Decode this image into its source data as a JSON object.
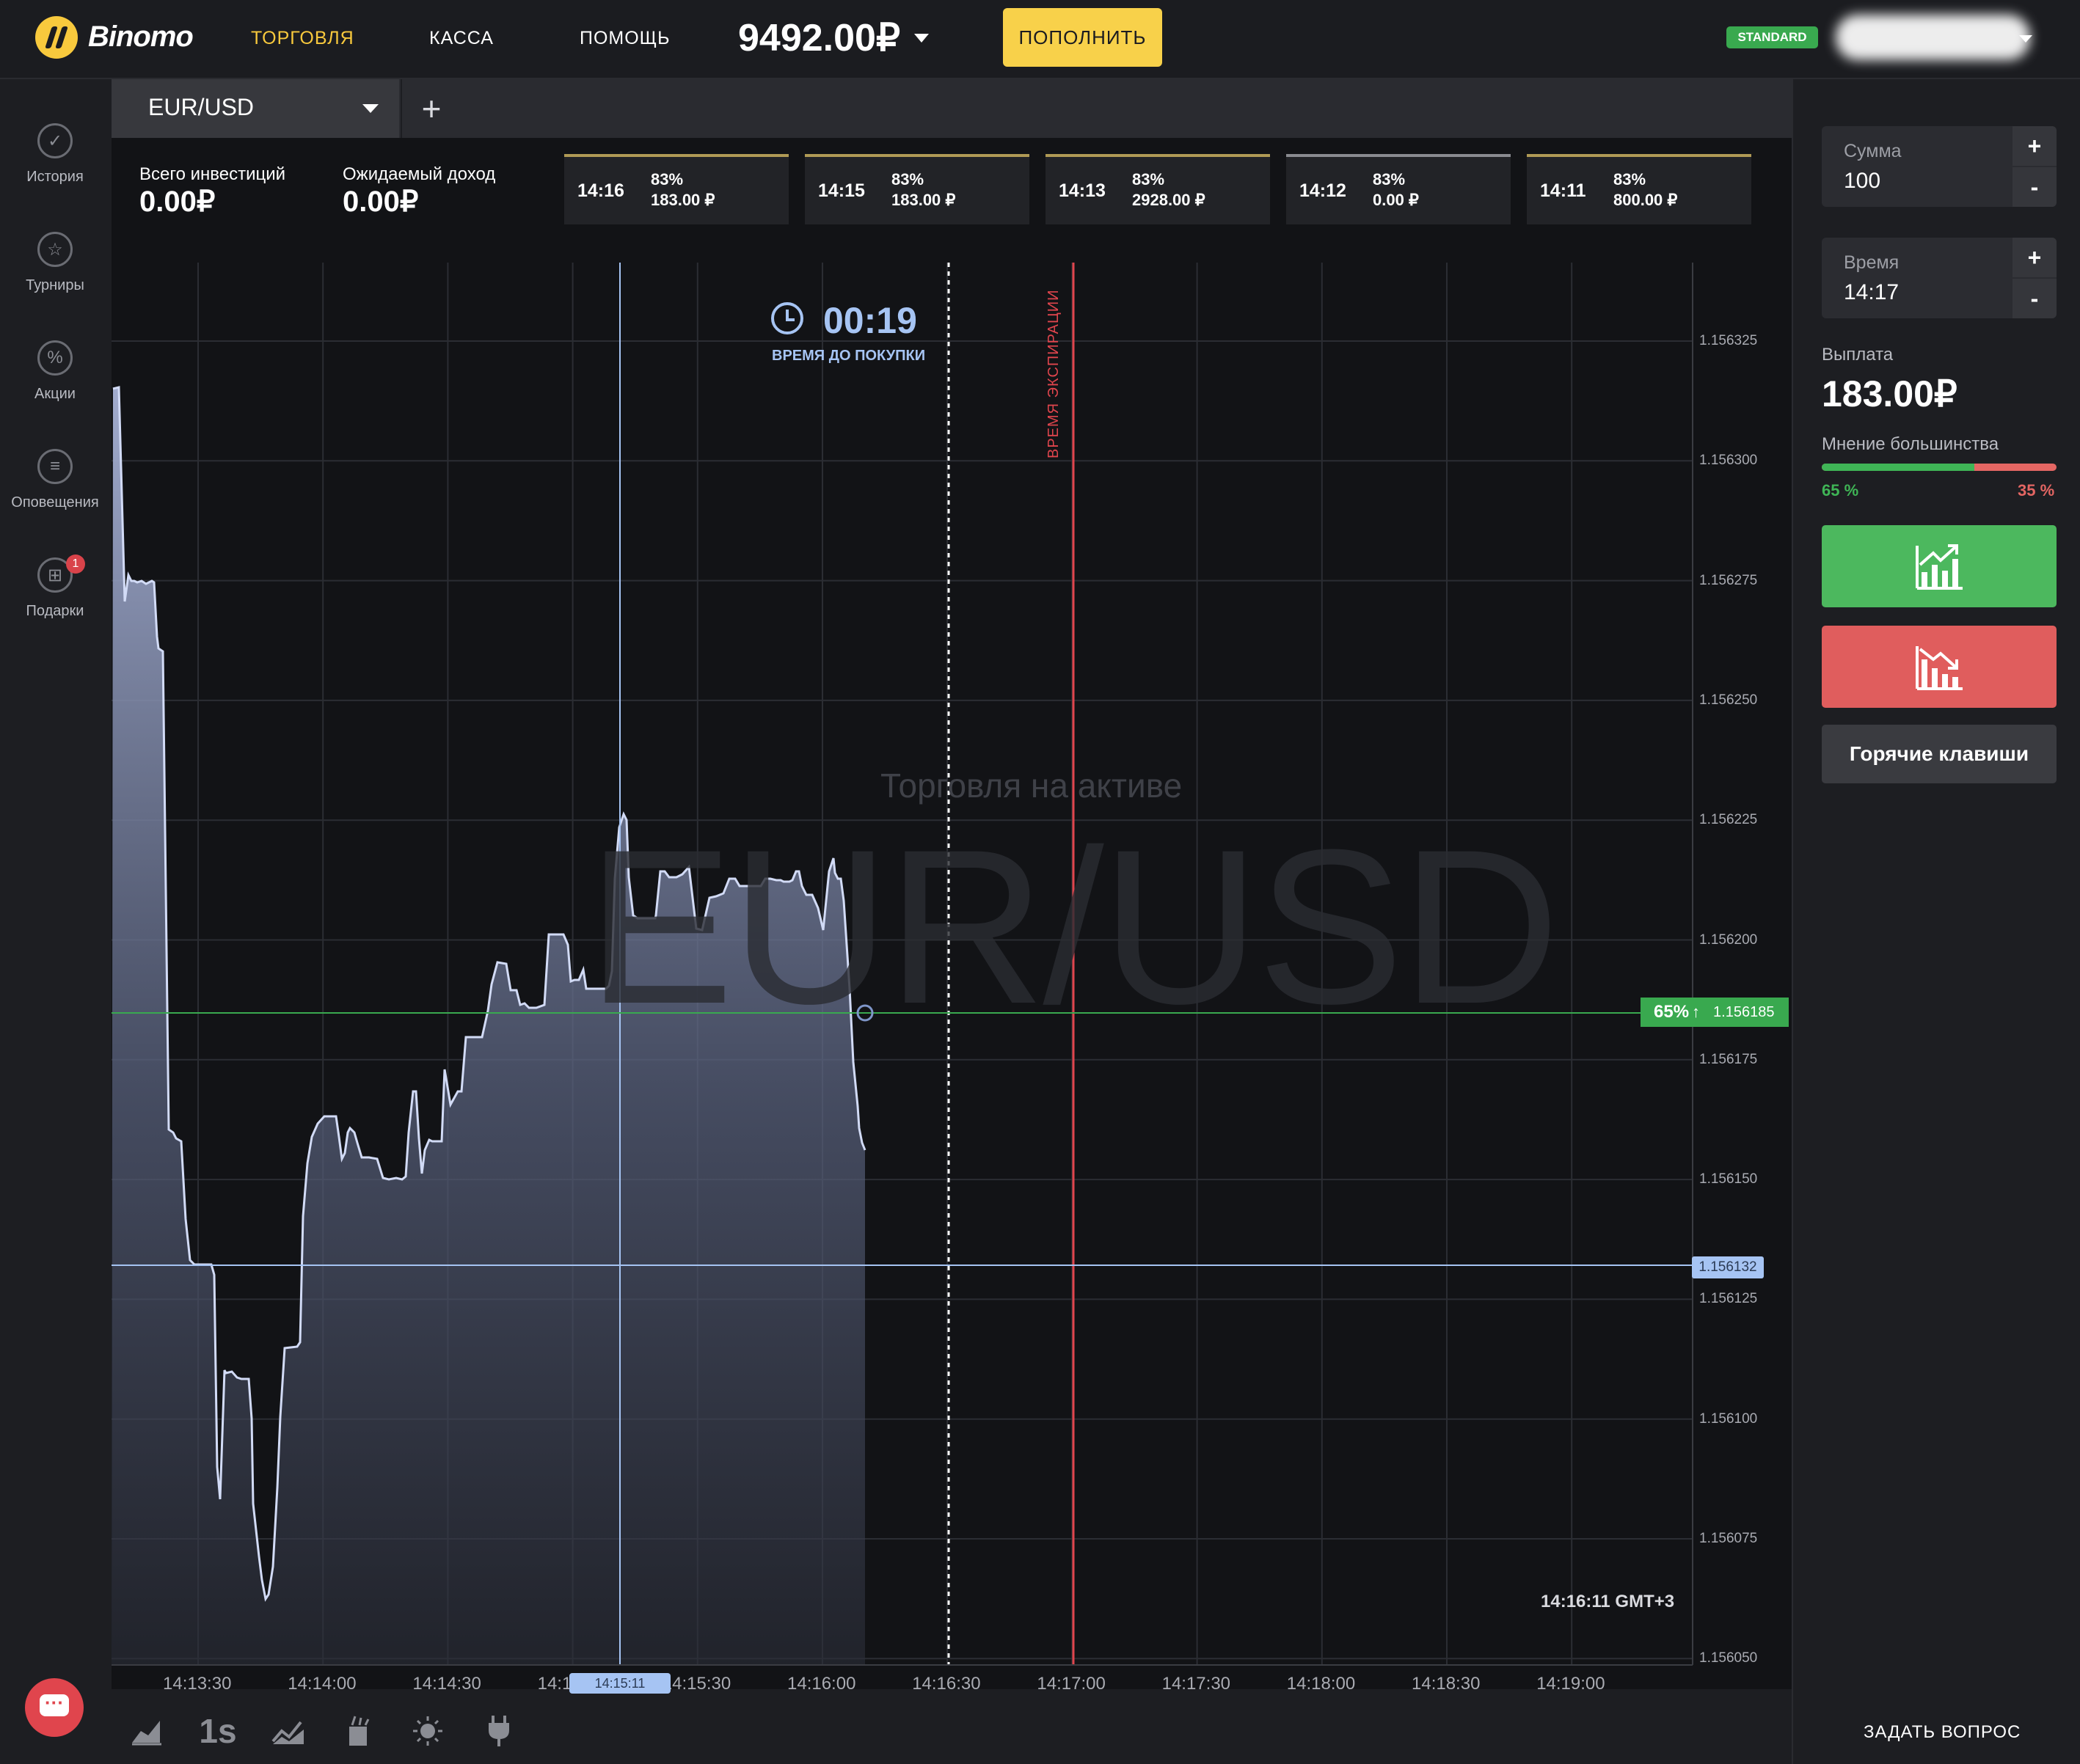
{
  "header": {
    "logo_text": "Binomo",
    "nav": {
      "trade": "ТОРГОВЛЯ",
      "cash": "КАССА",
      "help": "ПОМОЩЬ"
    },
    "balance": "9492.00₽",
    "deposit_label": "ПОПОЛНИТЬ",
    "account_badge": "STANDARD"
  },
  "sidebar": {
    "items": [
      {
        "label": "История",
        "icon": "history-icon"
      },
      {
        "label": "Турниры",
        "icon": "tournaments-icon"
      },
      {
        "label": "Акции",
        "icon": "promotions-icon"
      },
      {
        "label": "Оповещения",
        "icon": "notifications-icon"
      },
      {
        "label": "Подарки",
        "icon": "gift-icon"
      }
    ],
    "gift_badge_count": "1"
  },
  "asset_tabs": {
    "active": "EUR/USD",
    "add_label": "+"
  },
  "investments": {
    "total_label": "Всего инвестиций",
    "total_value": "0.00₽",
    "expected_label": "Ожидаемый доход",
    "expected_value": "0.00₽"
  },
  "deals": [
    {
      "time": "14:16",
      "percent": "83%",
      "amount": "183.00 ₽",
      "state": "active"
    },
    {
      "time": "14:15",
      "percent": "83%",
      "amount": "183.00 ₽",
      "state": "active"
    },
    {
      "time": "14:13",
      "percent": "83%",
      "amount": "2928.00 ₽",
      "state": "active"
    },
    {
      "time": "14:12",
      "percent": "83%",
      "amount": "0.00 ₽",
      "state": "lost"
    },
    {
      "time": "14:11",
      "percent": "83%",
      "amount": "800.00 ₽",
      "state": "active"
    }
  ],
  "chart": {
    "timer_value": "00:19",
    "timer_label": "ВРЕМЯ ДО ПОКУПКИ",
    "expiry_label": "ВРЕМЯ ЭКСПИРАЦИИ",
    "watermark_sub": "Торговля на активе",
    "watermark_main": "EUR/USD",
    "server_time": "14:16:11 GMT+3",
    "current_time_label": "14:15:11",
    "current_price_label": "1.156132",
    "majority_pct_label": "65%",
    "majority_arrow": "↑",
    "majority_price_label": "1.156185",
    "price_ticks": [
      "1.156325",
      "1.156300",
      "1.156275",
      "1.156250",
      "1.156225",
      "1.156200",
      "1.156175",
      "1.156150",
      "1.156125",
      "1.156100",
      "1.156075",
      "1.156050"
    ],
    "time_ticks": [
      "14:13:30",
      "14:14:00",
      "14:14:30",
      "14:15:00",
      "14:15:30",
      "14:16:00",
      "14:16:30",
      "14:17:00",
      "14:17:30",
      "14:18:00",
      "14:18:30",
      "14:19:00"
    ],
    "colors": {
      "area_line": "#c9d4f2",
      "up": "#39a94f",
      "down": "#e0454d",
      "accent": "#f8c93d"
    }
  },
  "toolbar": {
    "interval": "1s",
    "tools": [
      "chart-type-icon",
      "indicators-icon",
      "drawing-tools-icon",
      "theme-icon",
      "plugins-icon"
    ]
  },
  "trade_panel": {
    "amount_label": "Сумма",
    "amount_value": "100",
    "time_label": "Время",
    "time_value": "14:17",
    "plus": "+",
    "minus": "-",
    "payout_label": "Выплата",
    "payout_value": "183.00₽",
    "opinion_label": "Мнение большинства",
    "opinion_up": 65,
    "opinion_up_label": "65 %",
    "opinion_down_label": "35 %",
    "hotkeys_label": "Горячие клавиши",
    "ask_label": "ЗАДАТЬ ВОПРОС"
  }
}
